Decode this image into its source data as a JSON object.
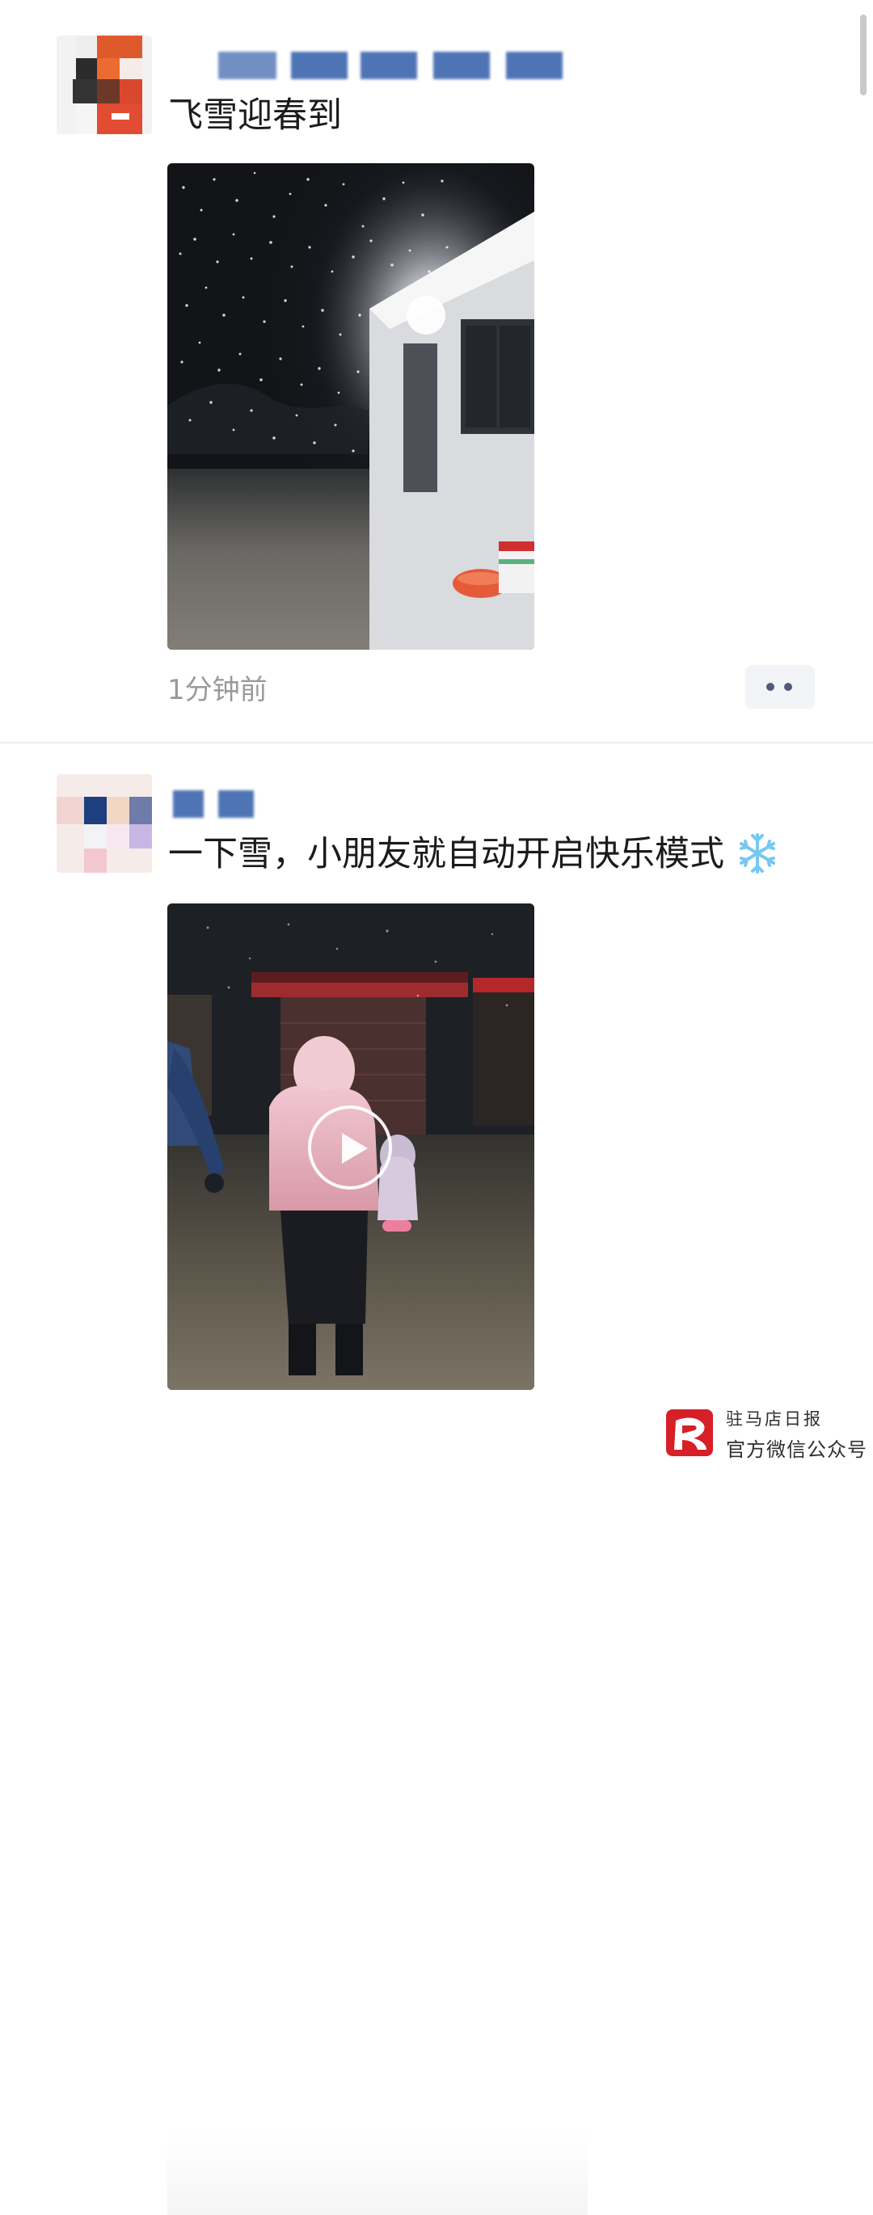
{
  "feed": {
    "posts": [
      {
        "text": "飞雪迎春到",
        "timestamp": "1分钟前",
        "media_type": "photo",
        "more_icon": "ellipsis-icon"
      },
      {
        "text": "一下雪，小朋友就自动开启快乐模式",
        "emoji": "❄️",
        "media_type": "video",
        "play_icon": "play-icon"
      }
    ]
  },
  "watermark": {
    "line1": "驻马店日报",
    "line2": "官方微信公众号",
    "logo_icon": "newspaper-logo-icon",
    "logo_color": "#d71f27"
  },
  "colors": {
    "text": "#1b1b1b",
    "timestamp": "#9a9a9a",
    "username_blur": "#4f74b5",
    "divider": "#ededed"
  }
}
